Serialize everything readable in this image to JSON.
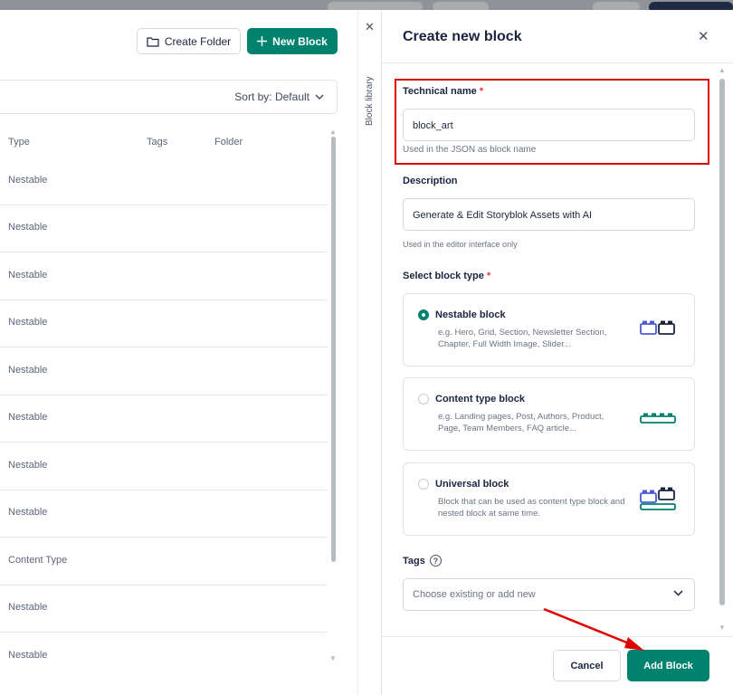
{
  "library": {
    "create_folder_label": "Create Folder",
    "new_block_label": "New Block",
    "sort_label": "Sort by: Default",
    "columns": [
      "Type",
      "Tags",
      "Folder"
    ],
    "rows": [
      "Nestable",
      "Nestable",
      "Nestable",
      "Nestable",
      "Nestable",
      "Nestable",
      "Nestable",
      "Nestable",
      "Content Type",
      "Nestable",
      "Nestable"
    ],
    "side_label": "Block library"
  },
  "drawer": {
    "title": "Create new block",
    "technical_name": {
      "label": "Technical name",
      "required": "*",
      "value": "block_art",
      "hint": "Used in the JSON as block name"
    },
    "description": {
      "label": "Description",
      "value": "Generate & Edit Storyblok Assets with AI",
      "hint": "Used in the editor interface only"
    },
    "block_type": {
      "label": "Select block type",
      "required": "*",
      "options": [
        {
          "title": "Nestable block",
          "desc": "e.g. Hero, Grid, Section, Newsletter Section, Chapter, Full Width Image, Slider...",
          "selected": true
        },
        {
          "title": "Content type block",
          "desc": "e.g. Landing pages, Post, Authors, Product, Page, Team Members, FAQ article...",
          "selected": false
        },
        {
          "title": "Universal block",
          "desc": "Block that can be used as content type block and nested block at same time.",
          "selected": false
        }
      ]
    },
    "tags": {
      "label": "Tags",
      "help": "?",
      "placeholder": "Choose existing or add new"
    },
    "cancel_label": "Cancel",
    "add_label": "Add Block"
  },
  "colors": {
    "brand": "#00826f",
    "highlight": "#e00000",
    "required": "#e0383e"
  },
  "icons": [
    "folder-icon",
    "plus-icon",
    "chevron-down-icon",
    "close-icon",
    "help-icon"
  ]
}
